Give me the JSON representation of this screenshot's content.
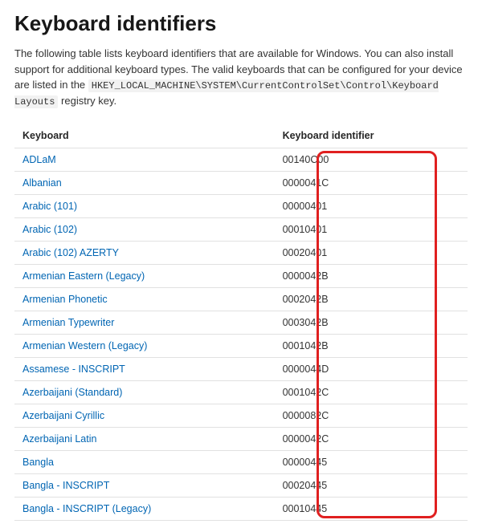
{
  "title": "Keyboard identifiers",
  "intro": {
    "before": "The following table lists keyboard identifiers that are available for Windows. You can also install support for additional keyboard types. The valid keyboards that can be configured for your device are listed in the ",
    "code": "HKEY_LOCAL_MACHINE\\SYSTEM\\CurrentControlSet\\Control\\Keyboard Layouts",
    "after": " registry key."
  },
  "columns": {
    "c1": "Keyboard",
    "c2": "Keyboard identifier"
  },
  "rows": [
    {
      "name": "ADLaM",
      "id": "00140C00"
    },
    {
      "name": "Albanian",
      "id": "0000041C"
    },
    {
      "name": "Arabic (101)",
      "id": "00000401"
    },
    {
      "name": "Arabic (102)",
      "id": "00010401"
    },
    {
      "name": "Arabic (102) AZERTY",
      "id": "00020401"
    },
    {
      "name": "Armenian Eastern (Legacy)",
      "id": "0000042B"
    },
    {
      "name": "Armenian Phonetic",
      "id": "0002042B"
    },
    {
      "name": "Armenian Typewriter",
      "id": "0003042B"
    },
    {
      "name": "Armenian Western (Legacy)",
      "id": "0001042B"
    },
    {
      "name": "Assamese - INSCRIPT",
      "id": "0000044D"
    },
    {
      "name": "Azerbaijani (Standard)",
      "id": "0001042C"
    },
    {
      "name": "Azerbaijani Cyrillic",
      "id": "0000082C"
    },
    {
      "name": "Azerbaijani Latin",
      "id": "0000042C"
    },
    {
      "name": "Bangla",
      "id": "00000445"
    },
    {
      "name": "Bangla - INSCRIPT",
      "id": "00020445"
    },
    {
      "name": "Bangla - INSCRIPT (Legacy)",
      "id": "00010445"
    }
  ]
}
